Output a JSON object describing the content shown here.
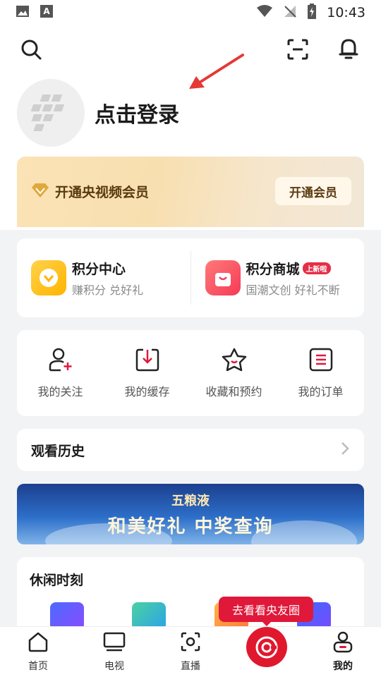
{
  "status_bar": {
    "time": "10:43"
  },
  "profile": {
    "login_label": "点击登录"
  },
  "vip": {
    "title": "开通央视频会员",
    "button_label": "开通会员"
  },
  "points": [
    {
      "title": "积分中心",
      "subtitle": "赚积分 兑好礼",
      "badge": ""
    },
    {
      "title": "积分商城",
      "subtitle": "国潮文创 好礼不断",
      "badge": "上新啦"
    }
  ],
  "quick_actions": [
    {
      "label": "我的关注",
      "icon": "person-add-icon"
    },
    {
      "label": "我的缓存",
      "icon": "download-icon"
    },
    {
      "label": "收藏和预约",
      "icon": "star-icon"
    },
    {
      "label": "我的订单",
      "icon": "order-icon"
    }
  ],
  "history": {
    "title": "观看历史"
  },
  "banner": {
    "brand": "五粮液",
    "title": "和美好礼 中奖查询"
  },
  "leisure": {
    "title": "休闲时刻"
  },
  "tooltip": {
    "text": "去看看央友圈"
  },
  "tabs": [
    {
      "label": "首页",
      "icon": "home-icon"
    },
    {
      "label": "电视",
      "icon": "tv-icon"
    },
    {
      "label": "直播",
      "icon": "live-icon"
    },
    {
      "label": "",
      "icon": "friends-circle-icon"
    },
    {
      "label": "我的",
      "icon": "profile-icon"
    }
  ],
  "colors": {
    "accent": "#e0183a",
    "vip_text": "#5a3a10"
  }
}
